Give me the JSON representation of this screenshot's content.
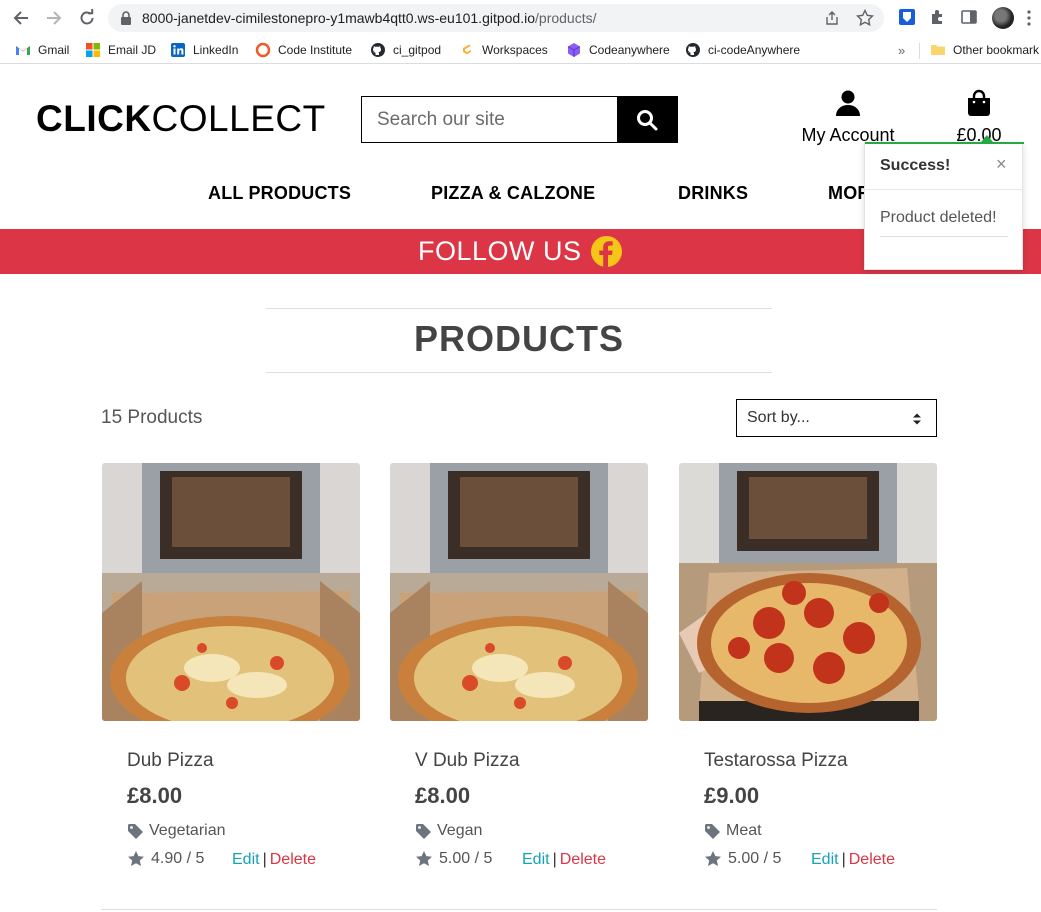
{
  "browser": {
    "url_host": "8000-janetdev-cimilestonepro-y1mawb4qtt0.ws-eu101.gitpod.io",
    "url_path": "/products/",
    "bookmarks": [
      "Gmail",
      "Email JD",
      "LinkedIn",
      "Code Institute",
      "ci_gitpod",
      "Workspaces",
      "Codeanywhere",
      "ci-codeAnywhere"
    ],
    "bookmarks_overflow": "»",
    "other_bookmarks": "Other bookmark"
  },
  "header": {
    "logo_bold": "CLICK",
    "logo_light": "COLLECT",
    "search_placeholder": "Search our site",
    "account_label": "My Account",
    "bag_total": "£0.00"
  },
  "nav": {
    "items": [
      "ALL PRODUCTS",
      "PIZZA & CALZONE",
      "DRINKS",
      "MORE"
    ]
  },
  "banner": {
    "text": "FOLLOW US"
  },
  "toast": {
    "title": "Success!",
    "close": "×",
    "message": "Product deleted!"
  },
  "page": {
    "title": "PRODUCTS",
    "count": "15 Products",
    "sort_label": "Sort by..."
  },
  "products": [
    {
      "name": "Dub Pizza",
      "price": "£8.00",
      "category": "Vegetarian",
      "rating": "4.90 / 5",
      "edit": "Edit",
      "sep": "|",
      "delete": "Delete"
    },
    {
      "name": "V Dub Pizza",
      "price": "£8.00",
      "category": "Vegan",
      "rating": "5.00 / 5",
      "edit": "Edit",
      "sep": "|",
      "delete": "Delete"
    },
    {
      "name": "Testarossa Pizza",
      "price": "£9.00",
      "category": "Meat",
      "rating": "5.00 / 5",
      "edit": "Edit",
      "sep": "|",
      "delete": "Delete"
    }
  ],
  "colors": {
    "banner": "#dc3545",
    "edit_link": "#17a2b8",
    "delete_link": "#dc3545",
    "toast_accent": "#28a745"
  }
}
